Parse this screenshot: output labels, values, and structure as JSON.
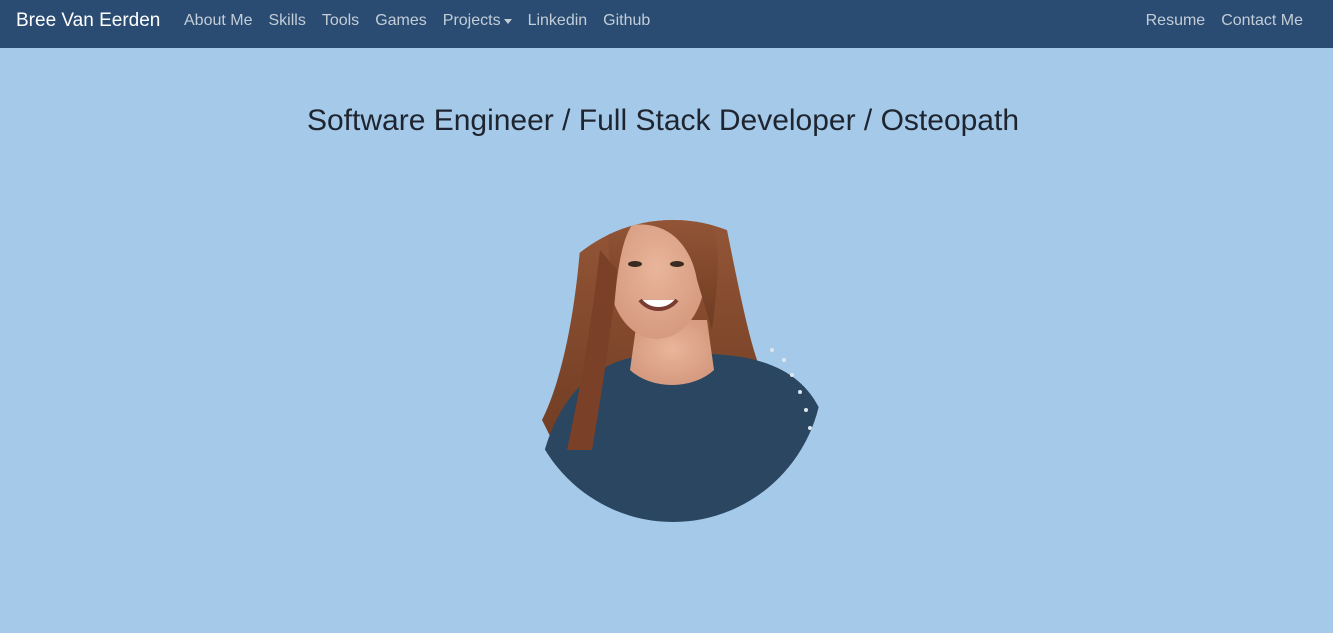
{
  "nav": {
    "brand": "Bree Van Eerden",
    "left_links": [
      "About Me",
      "Skills",
      "Tools",
      "Games",
      "Projects",
      "Linkedin",
      "Github"
    ],
    "right_links": [
      "Resume",
      "Contact Me"
    ]
  },
  "hero": {
    "title": "Software Engineer / Full Stack Developer / Osteopath"
  },
  "colors": {
    "navbar": "#2a4c72",
    "background": "#a5c9e8",
    "nav_link": "#c3cdd8",
    "title": "#1f2530"
  }
}
